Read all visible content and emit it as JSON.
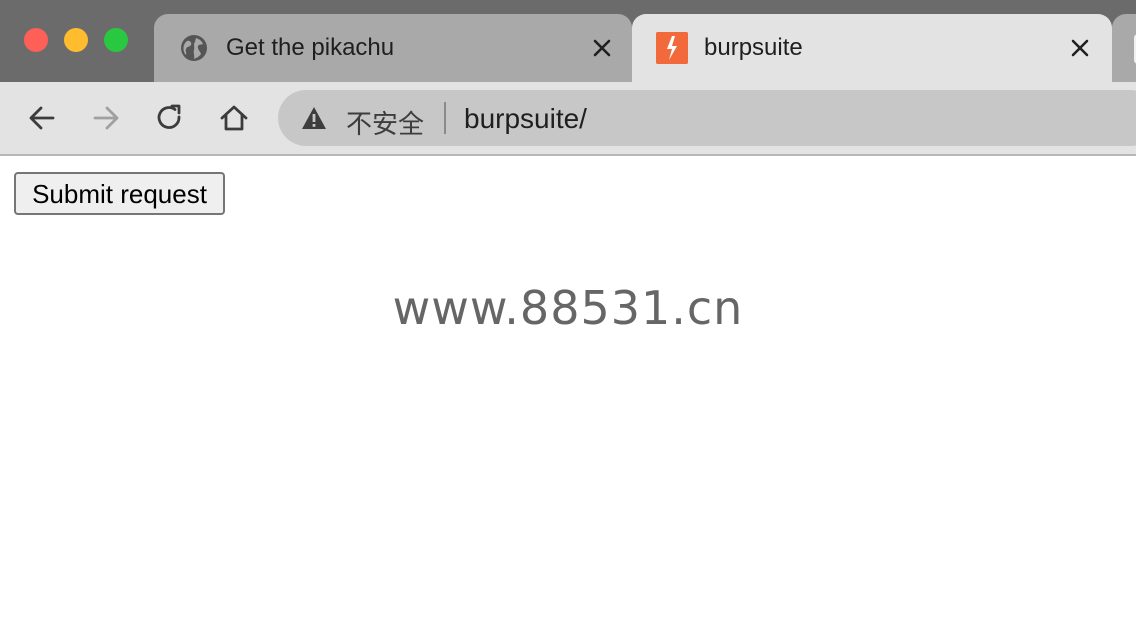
{
  "browser": {
    "tabs": [
      {
        "title": "Get the pikachu",
        "favicon": "globe-icon",
        "active": false
      },
      {
        "title": "burpsuite",
        "favicon": "burp-suite-icon",
        "active": true
      }
    ],
    "toolbar": {
      "security_label": "不安全",
      "url": "burpsuite/"
    }
  },
  "page": {
    "submit_label": "Submit request",
    "watermark": "www.88531.cn"
  },
  "colors": {
    "burp_accent": "#f26a3b",
    "traffic_close": "#fe5f57",
    "traffic_min": "#febc2e",
    "traffic_max": "#28c840"
  }
}
